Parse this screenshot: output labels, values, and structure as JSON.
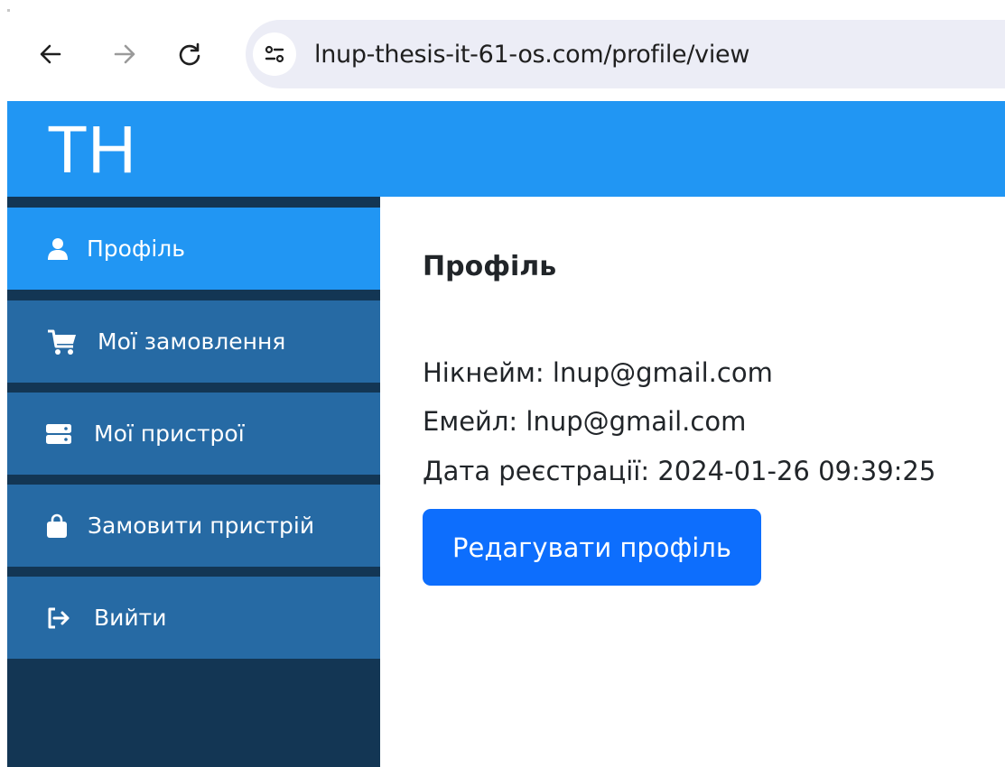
{
  "browser": {
    "url": "lnup-thesis-it-61-os.com/profile/view",
    "icons": {
      "back": "arrow-left-icon",
      "forward": "arrow-right-icon",
      "reload": "reload-icon",
      "site_info": "tune-icon"
    }
  },
  "app": {
    "logo": "TH",
    "header_color": "#2196f3"
  },
  "sidebar": {
    "items": [
      {
        "label": "Профіль",
        "icon": "user-icon",
        "active": true
      },
      {
        "label": "Мої замовлення",
        "icon": "cart-icon",
        "active": false
      },
      {
        "label": "Мої пристрої",
        "icon": "server-icon",
        "active": false
      },
      {
        "label": "Замовити пристрій",
        "icon": "shopping-bag-icon",
        "active": false
      },
      {
        "label": "Вийти",
        "icon": "logout-icon",
        "active": false
      }
    ],
    "colors": {
      "background": "#133654",
      "item": "#266aa4",
      "active": "#2196f3"
    }
  },
  "main": {
    "title": "Профіль",
    "info": [
      "Нікнейм: lnup@gmail.com",
      "Емейл: lnup@gmail.com",
      "Дата реєстрації: 2024-01-26 09:39:25"
    ],
    "edit_button": "Редагувати профіль",
    "button_color": "#0d6efd"
  }
}
